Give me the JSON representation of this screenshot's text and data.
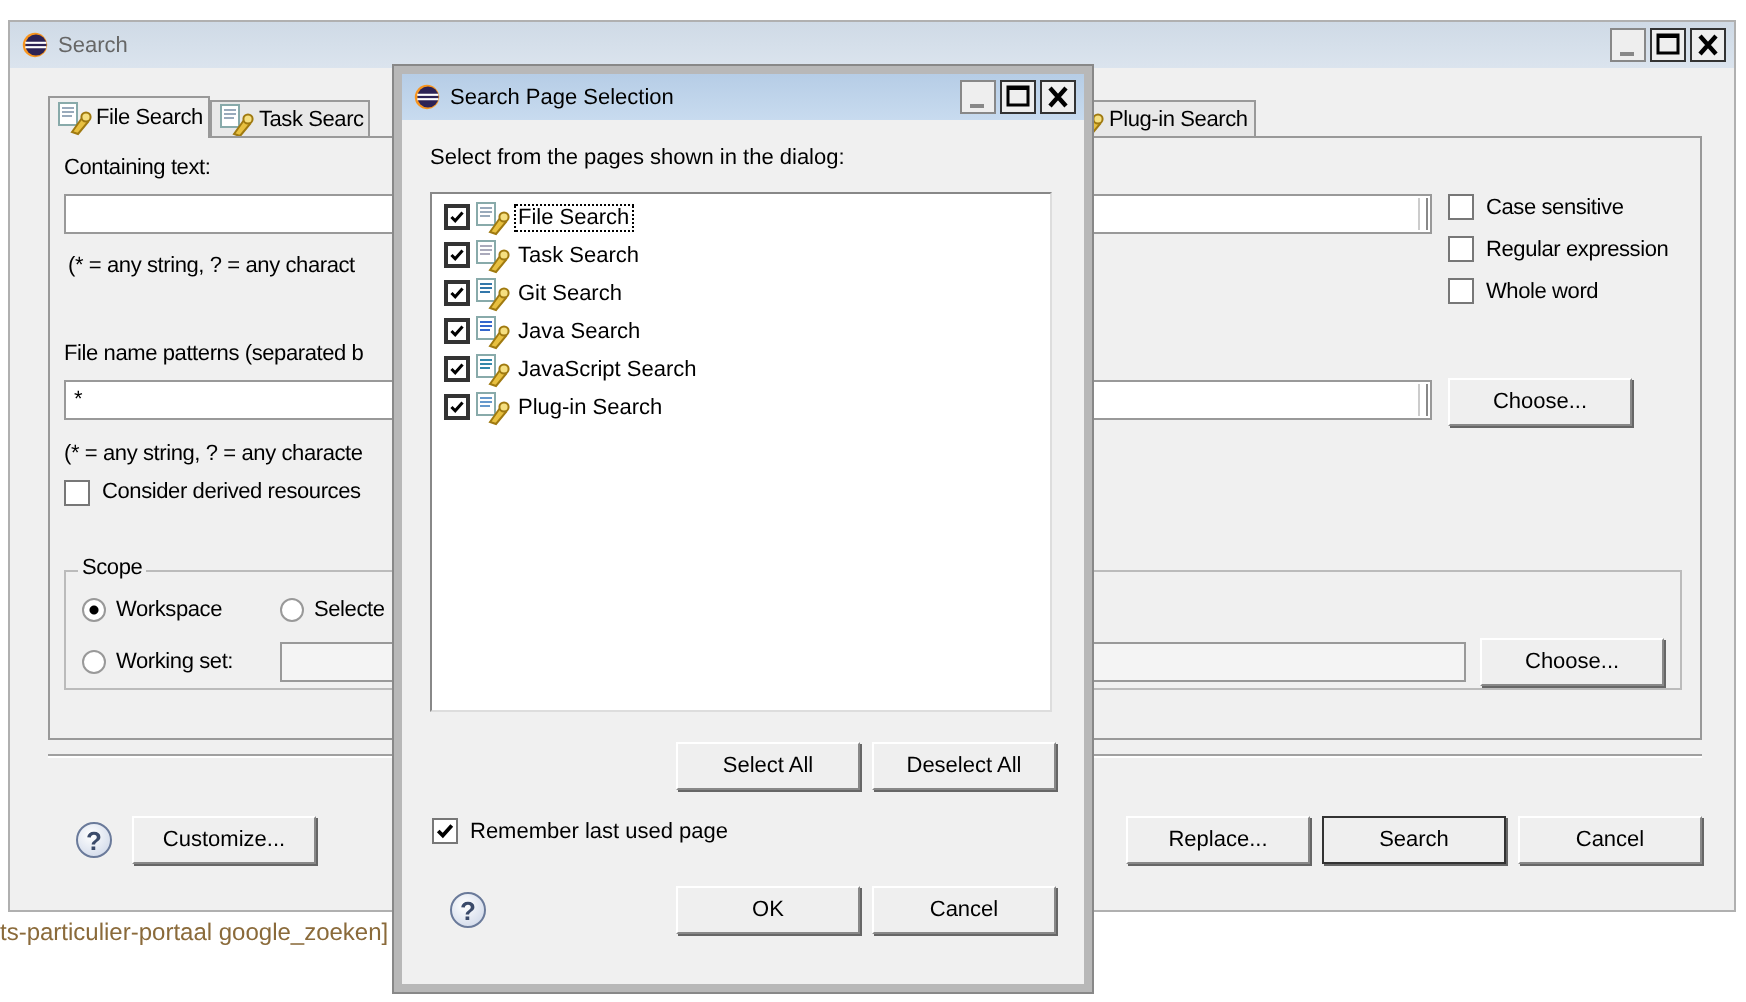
{
  "search_window": {
    "title": "Search",
    "tabs": [
      {
        "label": "File Search",
        "selected": true
      },
      {
        "label": "Task Searc",
        "selected": false
      },
      {
        "label": "Plug-in Search",
        "selected": false
      }
    ],
    "containing_text": {
      "label": "Containing text:",
      "hint": "(* = any string, ? = any charact"
    },
    "options": [
      {
        "label": "Case sensitive",
        "checked": false
      },
      {
        "label": "Regular expression",
        "checked": false
      },
      {
        "label": "Whole word",
        "checked": false
      }
    ],
    "file_name_patterns": {
      "label": "File name patterns (separated b",
      "value": "*",
      "hint": "(* = any string, ? = any characte"
    },
    "choose_button": "Choose...",
    "derived_resources": {
      "label": "Consider derived resources",
      "checked": false
    },
    "scope": {
      "title": "Scope",
      "options": [
        {
          "label": "Workspace",
          "selected": true
        },
        {
          "label": "Selecte",
          "selected": false
        },
        {
          "label": "Working set:",
          "selected": false
        }
      ],
      "choose_button": "Choose..."
    },
    "help": "?",
    "buttons": [
      "Customize...",
      "Replace...",
      "Search",
      "Cancel"
    ]
  },
  "selection_dialog": {
    "title": "Search Page Selection",
    "prompt": "Select from the pages shown in the dialog:",
    "pages": [
      {
        "label": "File Search",
        "checked": true,
        "focused": true
      },
      {
        "label": "Task Search",
        "checked": true,
        "focused": false
      },
      {
        "label": "Git Search",
        "checked": true,
        "focused": false
      },
      {
        "label": "Java Search",
        "checked": true,
        "focused": false
      },
      {
        "label": "JavaScript Search",
        "checked": true,
        "focused": false
      },
      {
        "label": "Plug-in Search",
        "checked": true,
        "focused": false
      }
    ],
    "select_buttons": [
      "Select All",
      "Deselect All"
    ],
    "remember": {
      "label": "Remember last used page",
      "checked": true
    },
    "help": "?",
    "buttons": [
      "OK",
      "Cancel"
    ]
  },
  "background_text": "ts-particulier-portaal google_zoeken]"
}
